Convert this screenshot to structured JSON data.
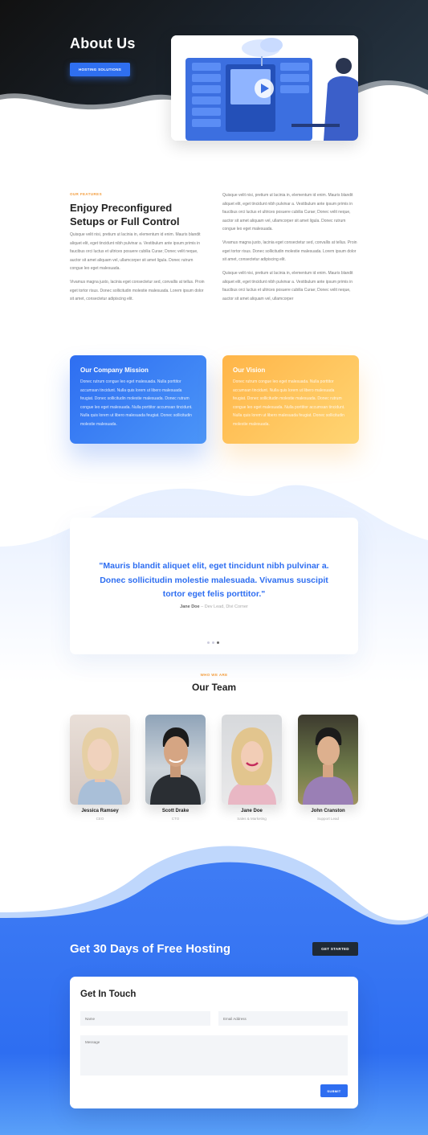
{
  "hero": {
    "title": "About Us",
    "button": "HOSTING SOLUTIONS"
  },
  "features": {
    "kicker": "OUR FEATURES",
    "title": "Enjoy Preconfigured Setups or Full Control",
    "left_p1": "Quisque velit nisi, pretium ut lacinia in, elementum id enim. Mauris blandit aliquet elit, eget tincidunt nibh pulvinar a. Vestibulum ante ipsum primis in faucibus orci luctus et ultrices posuere cubilia Curae; Donec velit neque, auctor sit amet aliquam vel, ullamcorper sit amet ligula. Donec rutrum congue leo eget malesuada.",
    "left_p2": "Vivamus magna justo, lacinia eget consectetur sed, convallis at tellus. Proin eget tortor risus. Donec sollicitudin molestie malesuada. Lorem ipsum dolor sit amet, consectetur adipiscing elit.",
    "right_p1": "Quisque velit nisi, pretium ut lacinia in, elementum id enim. Mauris blandit aliquet elit, eget tincidunt nibh pulvinar a. Vestibulum ante ipsum primis in faucibus orci luctus et ultrices posuere cubilia Curae; Donec velit neque, auctor sit amet aliquam vel, ullamcorper sit amet ligula. Donec rutrum congue leo eget malesuada.",
    "right_p2": "Vivamus magna justo, lacinia eget consectetur sed, convallis at tellus. Proin eget tortor risus. Donec sollicitudin molestie malesuada. Lorem ipsum dolor sit amet, consectetur adipiscing elit.",
    "right_p3": "Quisque velit nisi, pretium ut lacinia in, elementum id enim. Mauris blandit aliquet elit, eget tincidunt nibh pulvinar a. Vestibulum ante ipsum primis in faucibus orci luctus et ultrices posuere cubilia Curae; Donec velit neque, auctor sit amet aliquam vel, ullamcorper"
  },
  "cards": {
    "mission": {
      "title": "Our Company Mission",
      "text": "Donec rutrum congue leo eget malesuada. Nulla porttitor accumsan tincidunt. Nulla quis lorem ut libero malesuada feugiat. Donec sollicitudin molestie malesuada. Donec rutrum congue leo eget malesuada. Nulla porttitor accumsan tincidunt. Nulla quis lorem ut libero malesuada feugiat. Donec sollicitudin molestie malesuada."
    },
    "vision": {
      "title": "Our Vision",
      "text": "Donec rutrum congue leo eget malesuada. Nulla porttitor accumsan tincidunt. Nulla quis lorem ut libero malesuada feugiat. Donec sollicitudin molestie malesuada. Donec rutrum congue leo eget malesuada. Nulla porttitor accumsan tincidunt. Nulla quis lorem ut libero malesuada feugiat. Donec sollicitudin molestie malesuada."
    }
  },
  "testimonial": {
    "quote": "\"Mauris blandit aliquet elit, eget tincidunt nibh pulvinar a. Donec sollicitudin molestie malesuada. Vivamus suscipit tortor eget felis porttitor.\"",
    "author": "Jane Doe",
    "role": " – Dev Lead, Divi Corner"
  },
  "team": {
    "kicker": "WHO WE ARE",
    "title": "Our Team",
    "members": [
      {
        "name": "Jessica Ramsey",
        "role": "CEO"
      },
      {
        "name": "Scott Drake",
        "role": "CTO"
      },
      {
        "name": "Jane Doe",
        "role": "Sales & Marketing"
      },
      {
        "name": "John Cranston",
        "role": "Support Lead"
      }
    ]
  },
  "cta": {
    "title": "Get 30 Days of Free Hosting",
    "button": "GET STARTED"
  },
  "contact": {
    "title": "Get In Touch",
    "name_placeholder": "Name",
    "email_placeholder": "Email Address",
    "message_placeholder": "Message",
    "submit": "SUBMIT"
  },
  "colors": {
    "accent": "#2e6ef1",
    "orange": "#f39c3b",
    "dark": "#1f2a36"
  }
}
